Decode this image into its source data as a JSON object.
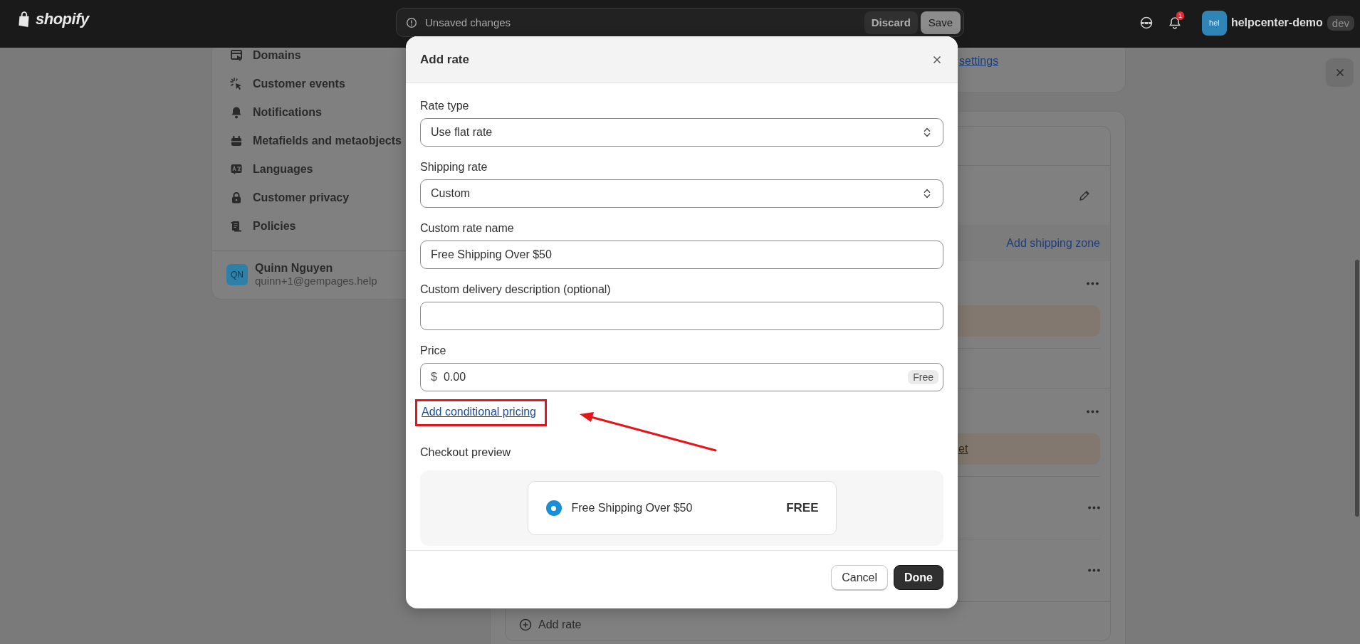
{
  "top_bar": {
    "logo": "shopify",
    "save_bar": {
      "message": "Unsaved changes",
      "buttons": [
        "Discard",
        "Save"
      ]
    },
    "notifications": {
      "badge": "1"
    },
    "account": {
      "avatar": "hel",
      "store": "helpcenter-demo",
      "badge": "dev"
    }
  },
  "sidebar": {
    "items": [
      {
        "label": "Domains"
      },
      {
        "label": "Customer events"
      },
      {
        "label": "Notifications"
      },
      {
        "label": "Metafields and metaobjects"
      },
      {
        "label": "Languages"
      },
      {
        "label": "Customer privacy"
      },
      {
        "label": "Policies"
      }
    ],
    "user": {
      "initials": "QN",
      "name": "Quinn Nguyen",
      "email": "quinn+1@gempages.help"
    }
  },
  "background": {
    "settings_link": "settings",
    "add_shipping_zone": "Add shipping zone",
    "groups": [
      {
        "rows": [
          {
            "kind": "notice"
          },
          {
            "kind": "plain"
          }
        ]
      },
      {
        "rows": [
          {
            "kind": "notice",
            "notice_link": "et"
          },
          {
            "kind": "menu"
          },
          {
            "kind": "menu"
          }
        ]
      }
    ],
    "add_rate": "Add rate"
  },
  "modal": {
    "title": "Add rate",
    "fields": [
      {
        "kind": "select",
        "label": "Rate type",
        "value": "Use flat rate"
      },
      {
        "kind": "select",
        "label": "Shipping rate",
        "value": "Custom"
      },
      {
        "kind": "text",
        "label": "Custom rate name",
        "value": "Free Shipping Over $50"
      },
      {
        "kind": "text",
        "label": "Custom delivery description (optional)"
      },
      {
        "kind": "price",
        "label": "Price",
        "prefix": "$",
        "value": "0.00",
        "badge": "Free"
      }
    ],
    "link": "Add conditional pricing",
    "preview": {
      "label": "Checkout preview",
      "option": {
        "name": "Free Shipping Over $50",
        "price": "FREE",
        "selected": true
      }
    },
    "buttons": [
      {
        "label": "Cancel",
        "kind": "secondary"
      },
      {
        "label": "Done",
        "kind": "primary"
      }
    ]
  },
  "annotation": {
    "highlight": true
  }
}
